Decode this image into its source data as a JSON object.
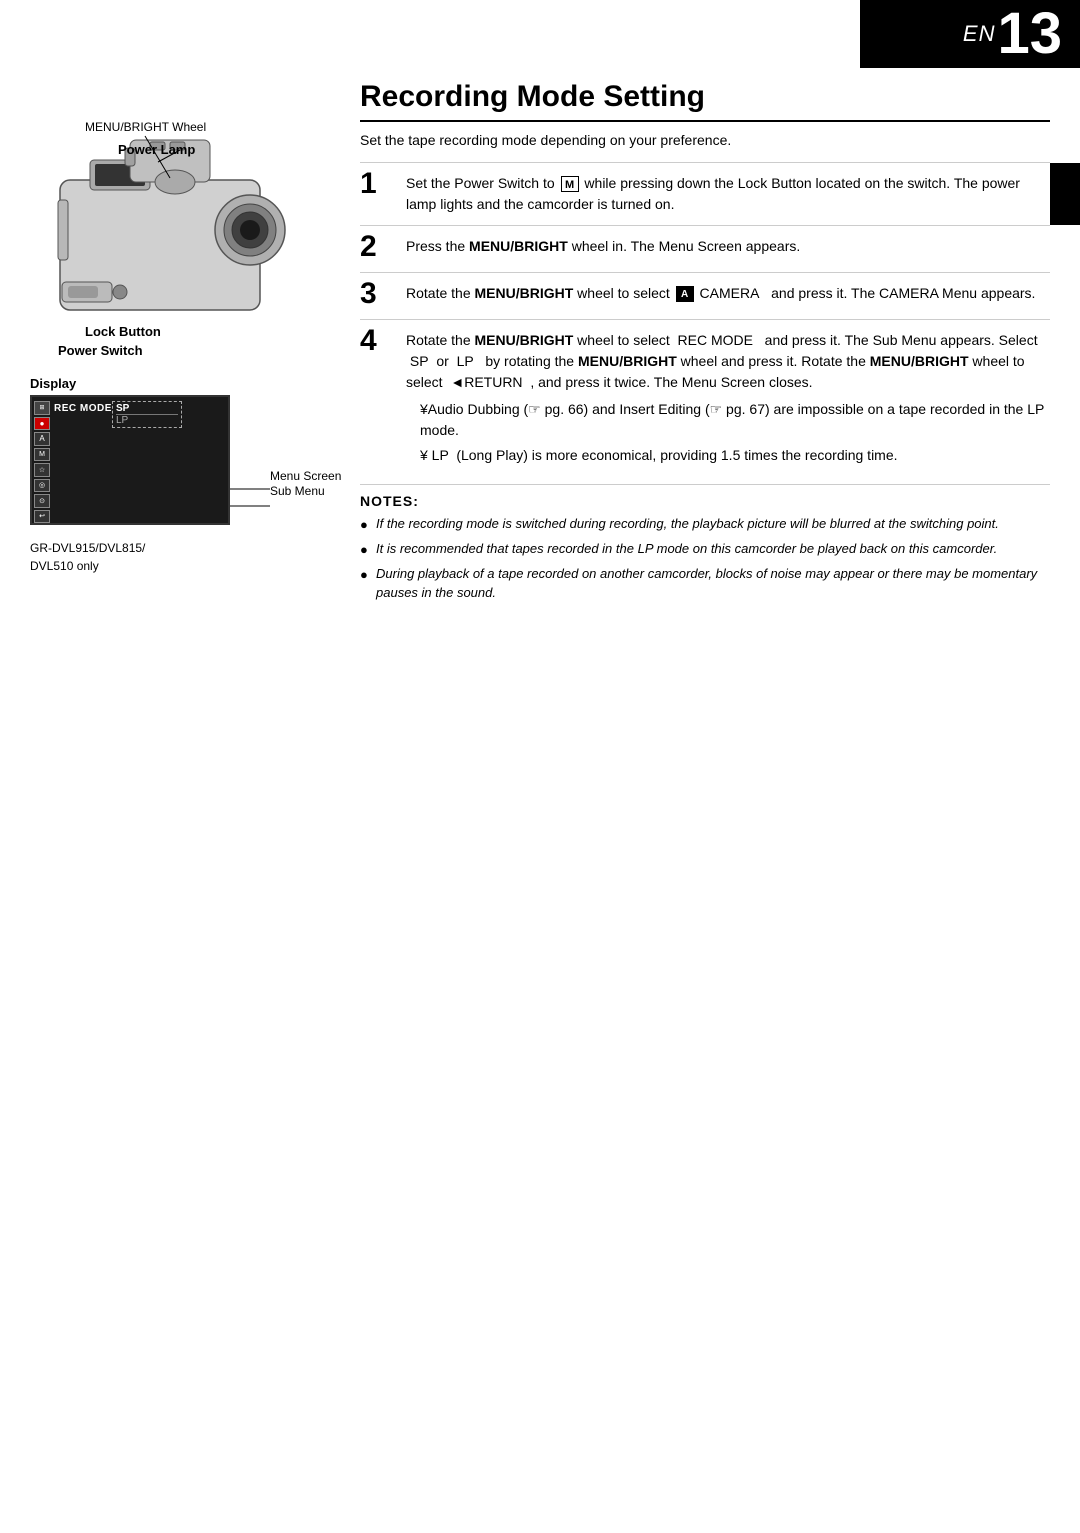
{
  "page": {
    "number": "13",
    "en_prefix": "EN"
  },
  "left_column": {
    "labels": {
      "menu_bright_wheel": "MENU/BRIGHT Wheel",
      "power_lamp": "Power Lamp",
      "lock_button": "Lock Button",
      "power_switch": "Power Switch",
      "display": "Display",
      "menu_screen": "Menu Screen",
      "sub_menu": "Sub Menu"
    },
    "screen": {
      "rec_mode": "REC MODE",
      "sp": "SP",
      "lp": "LP"
    },
    "model": "GR-DVL915/DVL815/\nDVL510 only"
  },
  "right_column": {
    "title": "Recording Mode Setting",
    "intro": "Set the tape recording mode depending on your preference.",
    "steps": [
      {
        "number": "1",
        "text_parts": [
          {
            "type": "normal",
            "text": "Set the Power Switch to "
          },
          {
            "type": "icon_m",
            "text": "M"
          },
          {
            "type": "normal",
            "text": " while pressing down the Lock Button located on the switch. The power lamp lights and the camcorder is turned on."
          }
        ],
        "has_bar": true
      },
      {
        "number": "2",
        "text_parts": [
          {
            "type": "normal",
            "text": "Press the "
          },
          {
            "type": "bold",
            "text": "MENU/BRIGHT"
          },
          {
            "type": "normal",
            "text": " wheel in. The Menu Screen appears."
          }
        ],
        "has_bar": false
      },
      {
        "number": "3",
        "text_parts": [
          {
            "type": "normal",
            "text": "Rotate the "
          },
          {
            "type": "bold",
            "text": "MENU/BRIGHT"
          },
          {
            "type": "normal",
            "text": " wheel to select "
          },
          {
            "type": "icon_cam",
            "text": "A"
          },
          {
            "type": "normal",
            "text": " CAMERA   and press it. The CAMERA Menu appears."
          }
        ],
        "has_bar": false
      },
      {
        "number": "4",
        "text_parts": [
          {
            "type": "normal",
            "text": "Rotate the "
          },
          {
            "type": "bold",
            "text": "MENU/BRIGHT"
          },
          {
            "type": "normal",
            "text": " wheel to select  REC MODE   and press it. The Sub Menu appears. Select  SP  or  LP   by rotating the "
          },
          {
            "type": "bold",
            "text": "MENU/BRIGHT"
          },
          {
            "type": "normal",
            "text": " wheel and press it. Rotate the "
          },
          {
            "type": "bold",
            "text": "MENU/BRIGHT"
          },
          {
            "type": "normal",
            "text": " wheel to select  ◄RETURN  , and press it twice. The Menu Screen closes."
          },
          {
            "type": "linebreak",
            "text": ""
          },
          {
            "type": "yen",
            "text": "¥Audio Dubbing (☞ pg. 66) and Insert Editing (☞ pg. 67) are impossible on a tape recorded in the LP mode."
          },
          {
            "type": "linebreak",
            "text": ""
          },
          {
            "type": "yen",
            "text": "¥ LP  (Long Play) is more economical, providing 1.5 times the recording time."
          }
        ],
        "has_bar": false
      }
    ],
    "notes": {
      "title": "NOTES:",
      "items": [
        "If the recording mode is switched during recording, the playback picture will be blurred at the switching point.",
        "It is recommended that tapes recorded in the LP mode on this camcorder be played back on this camcorder.",
        "During playback of a tape recorded on another camcorder, blocks of noise may appear or there may be momentary pauses in the sound."
      ]
    }
  }
}
